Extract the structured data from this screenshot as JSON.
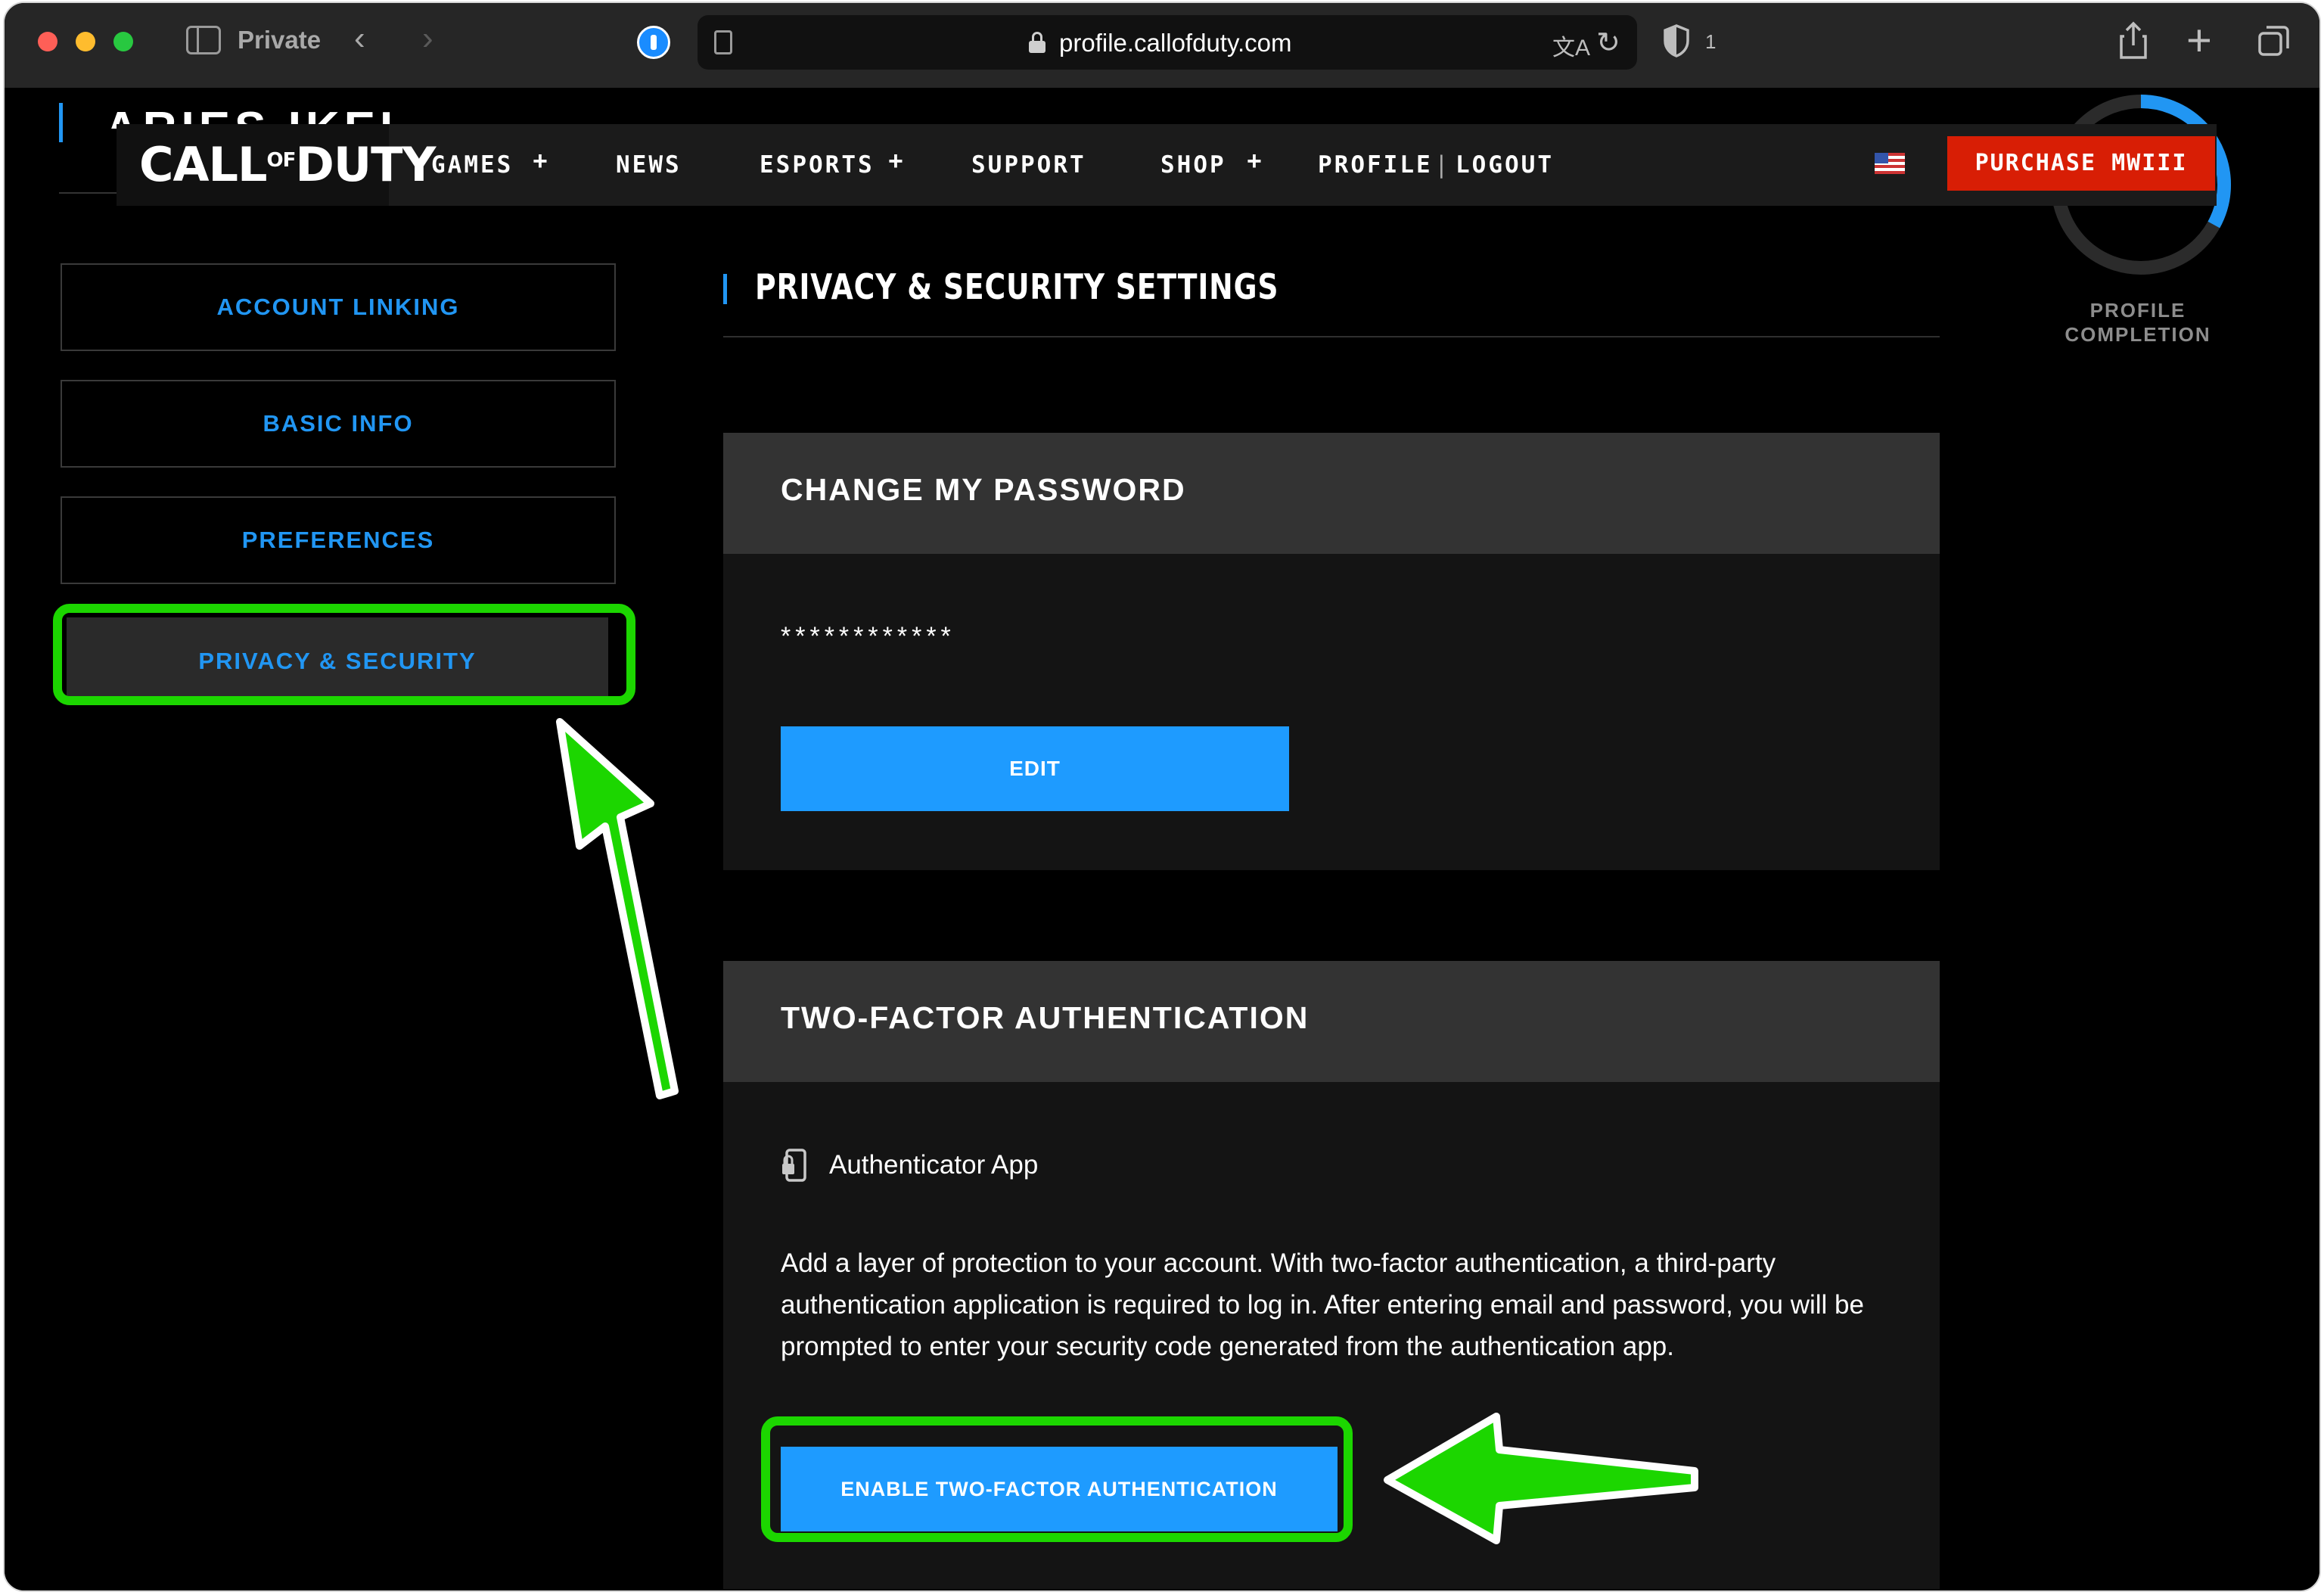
{
  "browser": {
    "private_label": "Private",
    "url": "profile.callofduty.com",
    "shield_count": "1",
    "back_arrow": "‹",
    "forward_arrow": "›",
    "new_tab": "+"
  },
  "header": {
    "profile_name_cut": "ARIES IKEL",
    "logo_call": "CALL",
    "logo_of": "OF",
    "logo_duty": "DUTY",
    "nav": {
      "games": "GAMES",
      "news": "NEWS",
      "esports": "ESPORTS",
      "support": "SUPPORT",
      "shop": "SHOP",
      "profile": "PROFILE",
      "separator": "|",
      "logout": "LOGOUT",
      "plus": "+"
    },
    "purchase_label": "PURCHASE MWIII"
  },
  "profile_completion": {
    "label_line1": "PROFILE",
    "label_line2": "COMPLETION",
    "fraction": 0.33,
    "ring_color": "#2196f3",
    "track_color": "#333333"
  },
  "sidebar": {
    "items": [
      {
        "label": "ACCOUNT LINKING",
        "active": false
      },
      {
        "label": "BASIC INFO",
        "active": false
      },
      {
        "label": "PREFERENCES",
        "active": false
      },
      {
        "label": "PRIVACY & SECURITY",
        "active": true
      }
    ]
  },
  "main": {
    "title": "PRIVACY & SECURITY SETTINGS",
    "password_card": {
      "title": "CHANGE MY PASSWORD",
      "masked_value": "************",
      "edit_label": "EDIT"
    },
    "twofa_card": {
      "title": "TWO-FACTOR AUTHENTICATION",
      "method_label": "Authenticator App",
      "description": "Add a layer of protection to your account. With two-factor authentication, a third-party authentication application is required to log in. After entering email and password, you will be prompted to enter your security code generated from the authentication app.",
      "enable_label": "ENABLE TWO-FACTOR AUTHENTICATION"
    }
  },
  "colors": {
    "accent_blue": "#1e9bff",
    "highlight_green": "#1cd600",
    "purchase_red": "#d81e05"
  }
}
